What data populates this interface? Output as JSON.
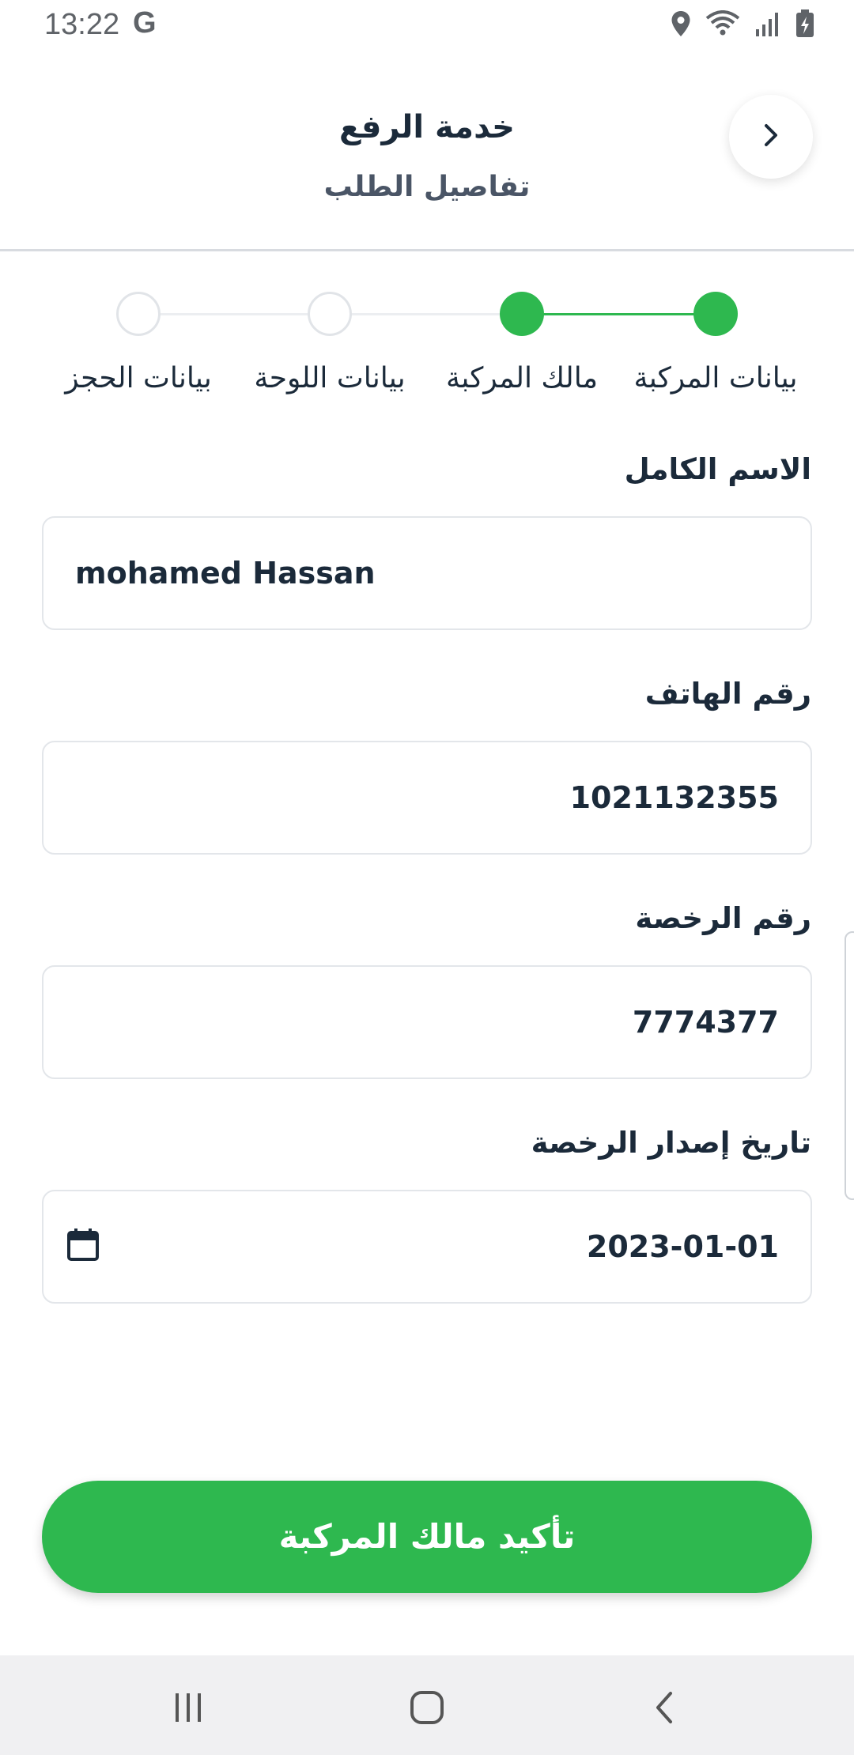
{
  "status_bar": {
    "time": "13:22",
    "google_indicator": "G",
    "icons": [
      "location-icon",
      "wifi-icon",
      "signal-icon",
      "battery-charging-icon"
    ]
  },
  "header": {
    "title": "خدمة الرفع",
    "subtitle": "تفاصيل الطلب",
    "back_icon": "chevron-right-icon"
  },
  "stepper": {
    "steps": [
      {
        "label": "بيانات المركبة",
        "state": "done"
      },
      {
        "label": "مالك المركبة",
        "state": "current"
      },
      {
        "label": "بيانات اللوحة",
        "state": "todo"
      },
      {
        "label": "بيانات الحجز",
        "state": "todo"
      }
    ],
    "active_color": "#2eb84f",
    "inactive_color": "#e1e4e8"
  },
  "form": {
    "full_name": {
      "label": "الاسم الكامل",
      "value": "mohamed Hassan"
    },
    "phone": {
      "label": "رقم الهاتف",
      "value": "1021132355"
    },
    "license_number": {
      "label": "رقم الرخصة",
      "value": "7774377"
    },
    "license_issue_date": {
      "label": "تاريخ إصدار الرخصة",
      "value": "2023-01-01",
      "icon": "calendar-icon"
    }
  },
  "confirm_button": {
    "label": "تأكيد مالك المركبة",
    "color": "#2eb84f"
  },
  "nav_bar": {
    "buttons": [
      "recent-apps-icon",
      "home-icon",
      "back-icon"
    ]
  }
}
